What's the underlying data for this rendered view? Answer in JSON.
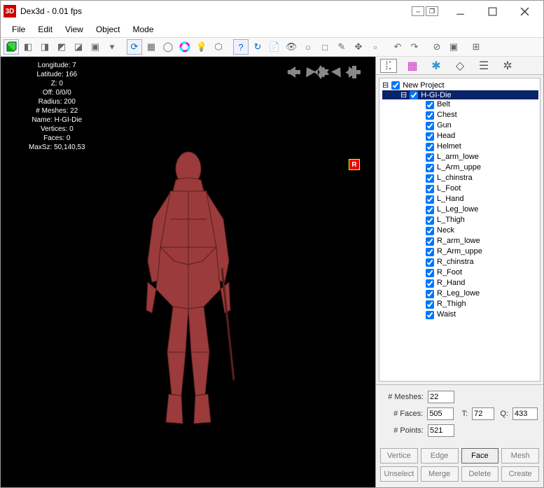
{
  "window": {
    "title": "Dex3d - 0.01 fps"
  },
  "menu": {
    "file": "File",
    "edit": "Edit",
    "view": "View",
    "object": "Object",
    "mode": "Mode"
  },
  "overlay": {
    "line1": "Longitude: 7",
    "line2": "Latitude: 166",
    "line3": "Z: 0",
    "line4": "Off: 0/0/0",
    "line5": "Radius: 200",
    "line6": "# Meshes: 22",
    "line7": "Name: H-GI-Die",
    "line8": "Vertices: 0",
    "line9": "Faces: 0",
    "line10": "MaxSz: 50,140,53"
  },
  "rbadge": "R",
  "tree": {
    "root": "New Project",
    "selected": "H-GI-Die",
    "items": [
      "Belt",
      "Chest",
      "Gun",
      "Head",
      "Helmet",
      "L_arm_lowe",
      "L_Arm_uppe",
      "L_chinstra",
      "L_Foot",
      "L_Hand",
      "L_Leg_lowe",
      "L_Thigh",
      "Neck",
      "R_arm_lowe",
      "R_Arm_uppe",
      "R_chinstra",
      "R_Foot",
      "R_Hand",
      "R_Leg_lowe",
      "R_Thigh",
      "Waist"
    ]
  },
  "stats": {
    "meshes_label": "# Meshes:",
    "meshes": "22",
    "faces_label": "# Faces:",
    "faces": "505",
    "t_label": "T:",
    "t": "72",
    "q_label": "Q:",
    "q": "433",
    "points_label": "# Points:",
    "points": "521"
  },
  "buttons": {
    "vertice": "Vertice",
    "edge": "Edge",
    "face": "Face",
    "mesh": "Mesh",
    "unselect": "Unselect",
    "merge": "Merge",
    "delete": "Delete",
    "create": "Create"
  }
}
